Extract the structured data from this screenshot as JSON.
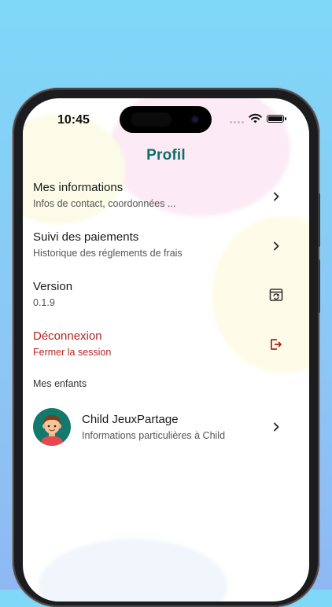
{
  "status_bar": {
    "time": "10:45"
  },
  "header": {
    "title": "Profil"
  },
  "menu": [
    {
      "title": "Mes informations",
      "subtitle": "Infos de contact, coordonnées ...",
      "icon": "chevron-right-icon"
    },
    {
      "title": "Suivi des paiements",
      "subtitle": "Historique des réglements de frais",
      "icon": "chevron-right-icon"
    },
    {
      "title": "Version",
      "subtitle": "0.1.9",
      "icon": "update-icon"
    },
    {
      "title": "Déconnexion",
      "subtitle": "Fermer la session",
      "icon": "logout-icon"
    }
  ],
  "children_section": {
    "label": "Mes enfants",
    "children": [
      {
        "name": "Child JeuxPartage",
        "subtitle": "Informations particulières à Child",
        "icon": "chevron-right-icon"
      }
    ]
  },
  "colors": {
    "accent": "#0f6e6a",
    "danger": "#b52424",
    "background_top": "#7fd8f8",
    "background_bottom": "#8fb8f3"
  }
}
